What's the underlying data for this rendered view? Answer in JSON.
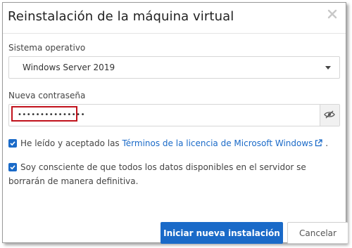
{
  "dialog": {
    "title": "Reinstalación de la máquina virtual",
    "close_icon": "close-icon"
  },
  "os": {
    "label": "Sistema operativo",
    "selected": "Windows Server 2019"
  },
  "password": {
    "label": "Nueva contraseña",
    "value": "•••••••••••••••",
    "toggle_icon": "eye-slash-icon"
  },
  "terms": {
    "checked": true,
    "text_before": "He leído y aceptado las ",
    "link_text": "Términos de la licencia de Microsoft Windows",
    "link_icon": "external-link-icon",
    "text_after": " ."
  },
  "consent": {
    "checked": true,
    "text": "Soy consciente de que todos los datos disponibles en el servidor se borrarán de manera definitiva."
  },
  "buttons": {
    "primary": "Iniciar nueva instalación",
    "secondary": "Cancelar"
  },
  "colors": {
    "accent": "#1a6ac8",
    "highlight": "#c1121c"
  }
}
